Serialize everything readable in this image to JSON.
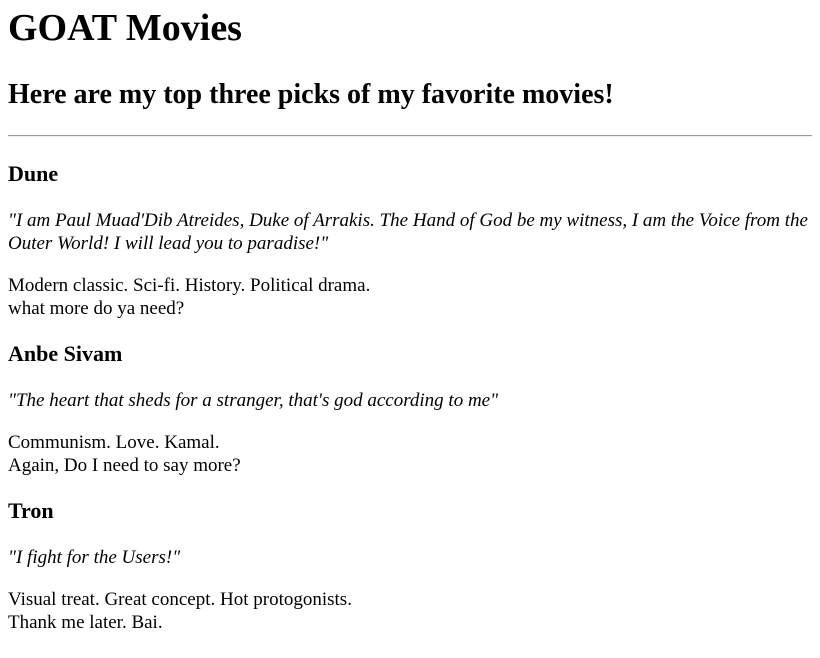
{
  "page": {
    "title": "GOAT Movies",
    "subtitle": "Here are my top three picks of my favorite movies!"
  },
  "movies": [
    {
      "title": "Dune",
      "quote": "\"I am Paul Muad'Dib Atreides, Duke of Arrakis. The Hand of God be my witness, I am the Voice from the Outer World! I will lead you to paradise!\"",
      "description_line1": "Modern classic. Sci-fi. History. Political drama.",
      "description_line2": "what more do ya need?"
    },
    {
      "title": "Anbe Sivam",
      "quote": "\"The heart that sheds for a stranger, that's god according to me\"",
      "description_line1": "Communism. Love. Kamal.",
      "description_line2": "Again, Do I need to say more?"
    },
    {
      "title": "Tron",
      "quote": "\"I fight for the Users!\"",
      "description_line1": "Visual treat. Great concept. Hot protogonists.",
      "description_line2": "Thank me later. Bai."
    }
  ]
}
